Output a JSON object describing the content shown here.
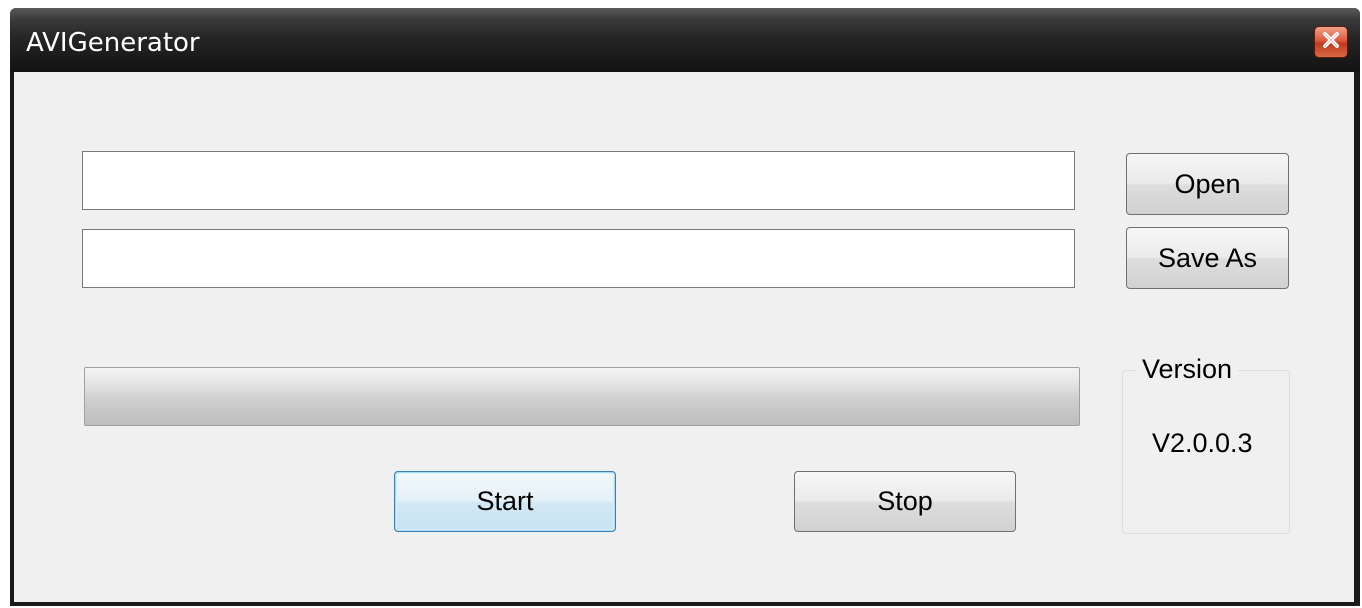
{
  "window": {
    "title": "AVIGenerator"
  },
  "inputs": {
    "source_path": {
      "value": "",
      "placeholder": ""
    },
    "output_path": {
      "value": "",
      "placeholder": ""
    }
  },
  "buttons": {
    "open_label": "Open",
    "save_as_label": "Save As",
    "start_label": "Start",
    "stop_label": "Stop"
  },
  "progress": {
    "value_fraction": 0
  },
  "version_group": {
    "legend": "Version",
    "value": "V2.0.0.3"
  },
  "icons": {
    "close": "close-icon"
  },
  "colors": {
    "titlebar": "#1a1a1a",
    "client_background": "#f0f0f0",
    "close_button": "#d4502e",
    "focus_border": "#3c7fb1"
  }
}
